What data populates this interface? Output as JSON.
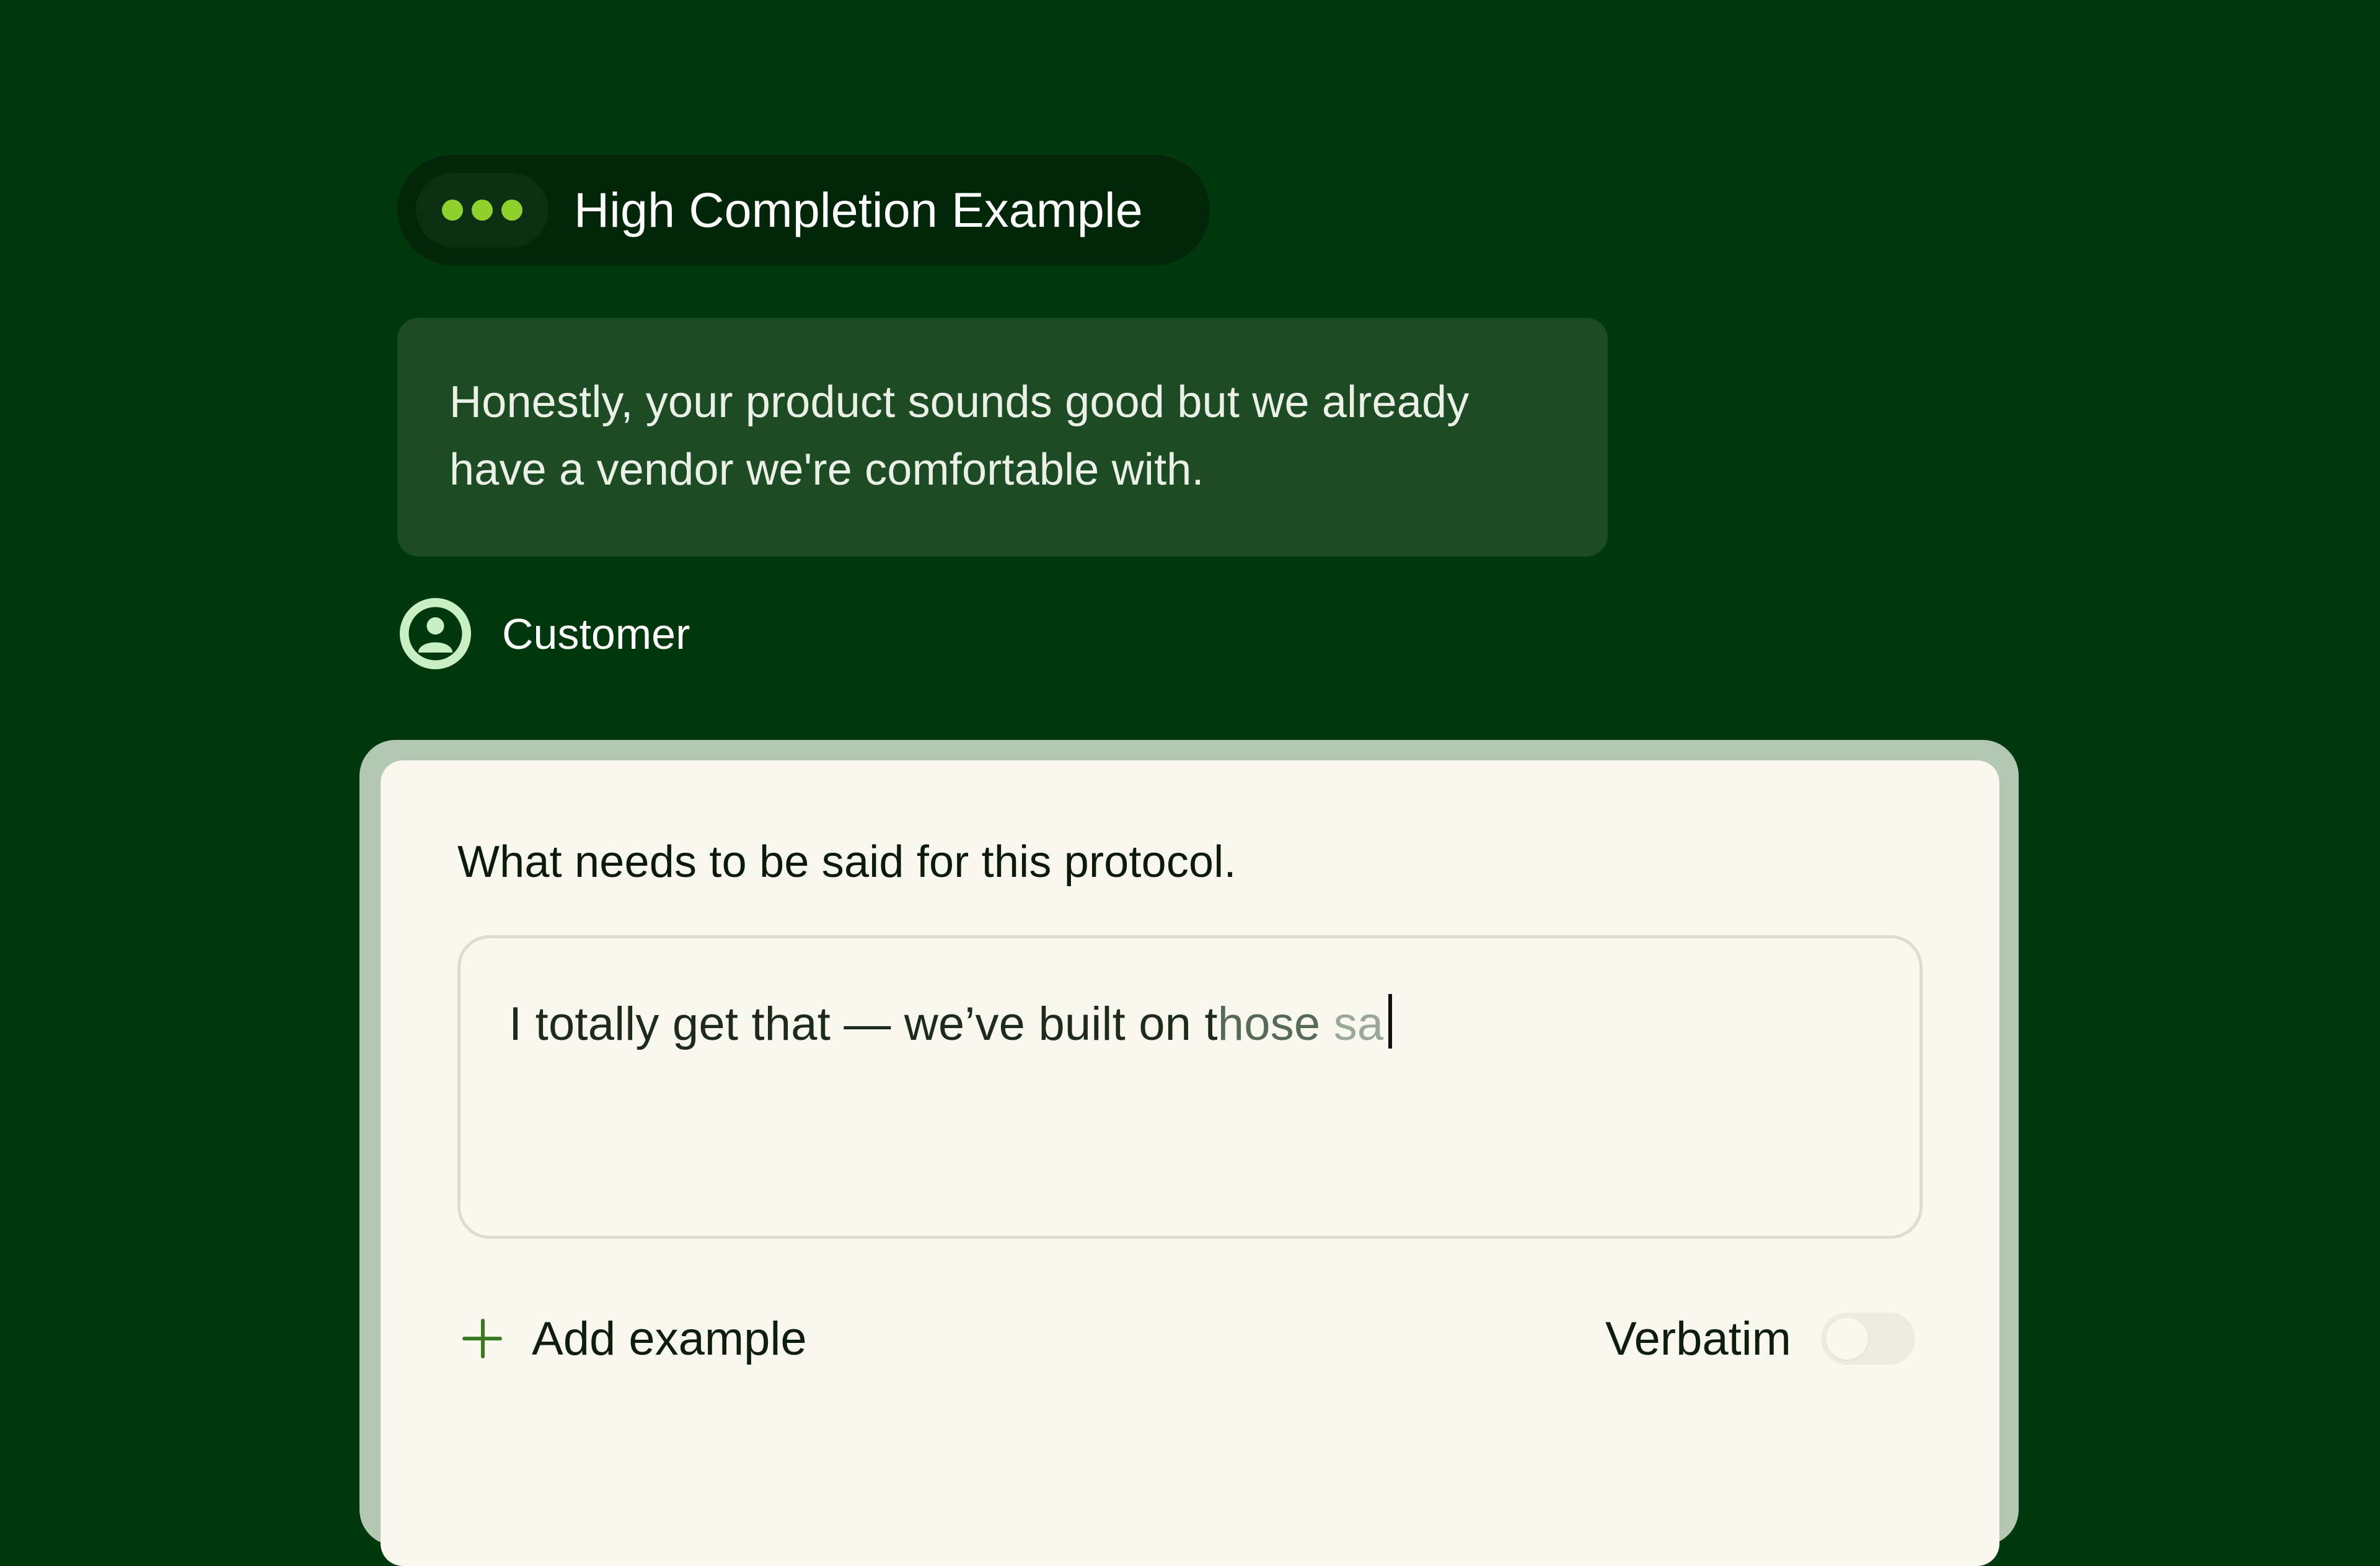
{
  "status_pill": {
    "label": "High Completion Example",
    "indicator_icon": "three-dots-icon",
    "dot_color": "#8ed12c"
  },
  "message": {
    "text": "Honestly, your product sounds good but we already have a vendor we're comfortable with.",
    "speaker": "Customer",
    "speaker_icon": "person-avatar-icon"
  },
  "card": {
    "heading": "What needs to be said for this protocol.",
    "input": {
      "value_solid": "I totally get that — we’ve built on t",
      "value_fade1": "hose",
      "value_fade2": " sa"
    },
    "add_example_label": "Add example",
    "add_example_icon": "plus-icon",
    "verbatim_label": "Verbatim",
    "verbatim_on": false
  },
  "colors": {
    "background": "#00380d",
    "bubble": "#1c4b24",
    "card": "#f8f8ef",
    "accent": "#3b7a22"
  }
}
